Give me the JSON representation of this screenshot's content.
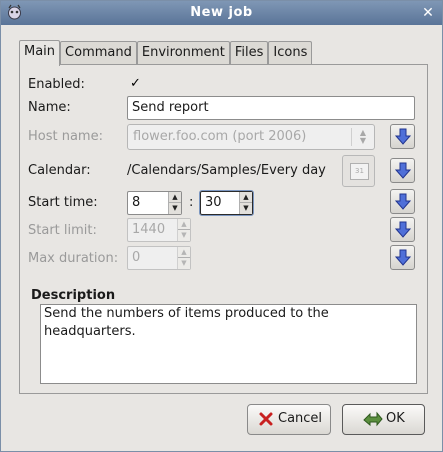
{
  "window": {
    "title": "New job"
  },
  "tabs": [
    "Main",
    "Command",
    "Environment",
    "Files",
    "Icons"
  ],
  "form": {
    "enabled_label": "Enabled:",
    "enabled_checked": true,
    "name_label": "Name:",
    "name_value": "Send report",
    "host_label": "Host name:",
    "host_value": "flower.foo.com (port 2006)",
    "calendar_label": "Calendar:",
    "calendar_value": "/Calendars/Samples/Every day",
    "calendar_icon_text": "31",
    "start_time_label": "Start time:",
    "start_hour": "8",
    "time_separator": ":",
    "start_minute": "30",
    "start_limit_label": "Start limit:",
    "start_limit_value": "1440",
    "max_duration_label": "Max duration:",
    "max_duration_value": "0"
  },
  "description": {
    "title": "Description",
    "text_line1": "Send the numbers of items produced to the",
    "text_line2": "headquarters."
  },
  "buttons": {
    "cancel": "Cancel",
    "ok": "OK"
  },
  "colors": {
    "titlebar": "#6b84a6",
    "arrow_icon": "#4f6fd8"
  }
}
